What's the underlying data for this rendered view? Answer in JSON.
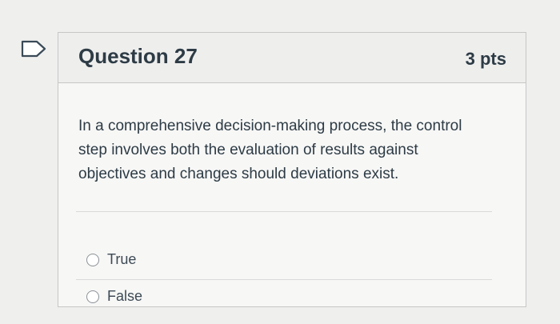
{
  "question": {
    "title": "Question 27",
    "points": "3 pts",
    "text": "In a comprehensive decision-making process, the control step involves both the evaluation of results against objectives and changes should deviations exist."
  },
  "answers": [
    {
      "label": "True",
      "selected": false
    },
    {
      "label": "False",
      "selected": false
    }
  ],
  "colors": {
    "accent_flag": "#2d3b45",
    "text": "#2d3b45"
  }
}
